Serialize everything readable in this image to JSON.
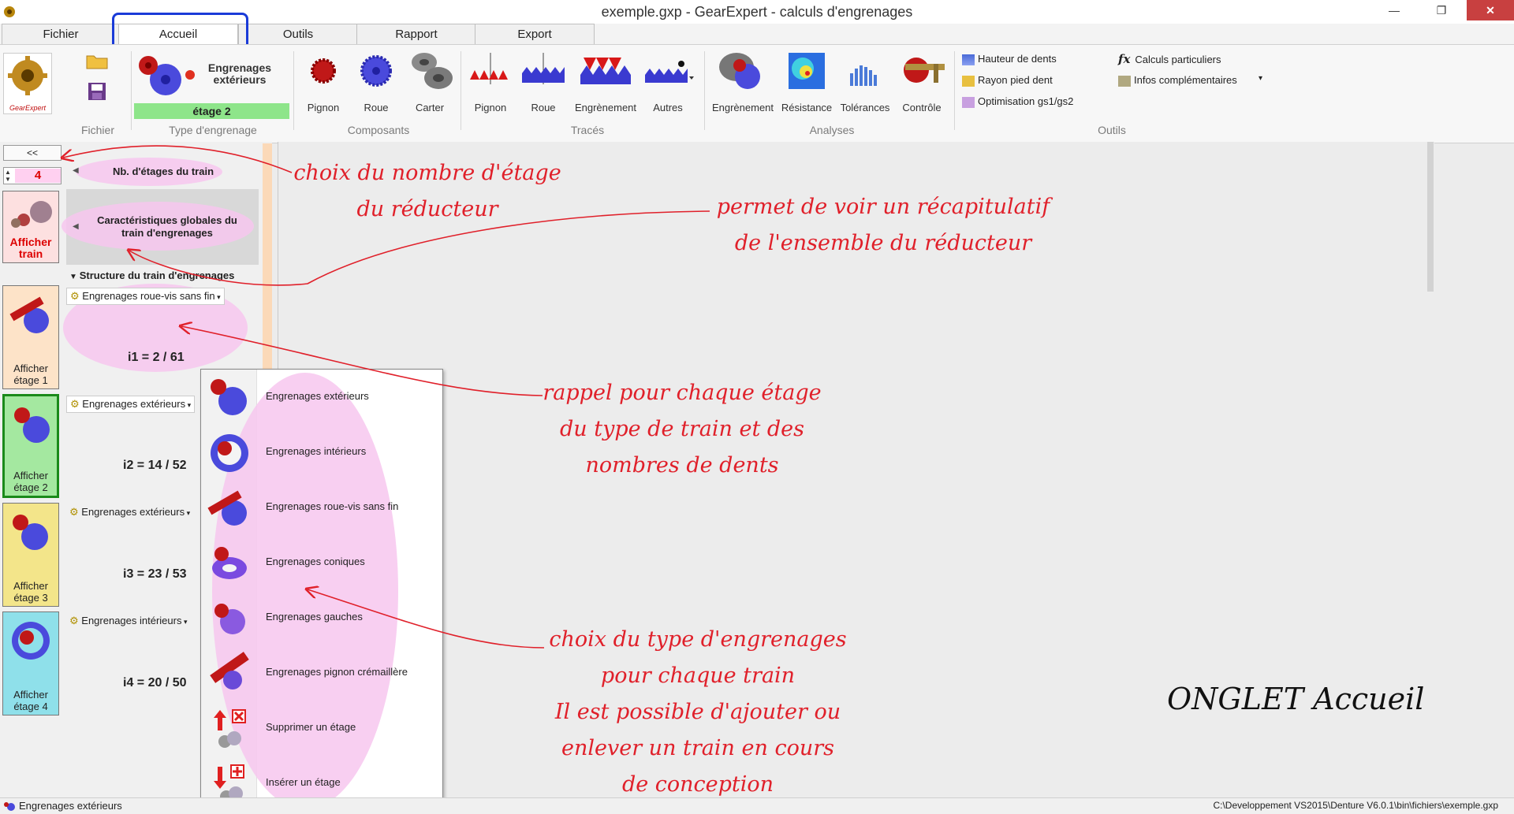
{
  "window": {
    "title": "exemple.gxp - GearExpert - calculs d'engrenages",
    "controls": {
      "minimize": "—",
      "maximize": "❐",
      "close": "✕"
    }
  },
  "tabs": [
    {
      "label": "Fichier"
    },
    {
      "label": "Accueil",
      "active": true
    },
    {
      "label": "Outils"
    },
    {
      "label": "Rapport"
    },
    {
      "label": "Export"
    }
  ],
  "ribbon": {
    "logo_text": "GearExpert",
    "gear_type": {
      "title": "Engrenages extérieurs",
      "stage": "étage 2"
    },
    "composants": [
      "Pignon",
      "Roue",
      "Carter"
    ],
    "traces": [
      "Pignon",
      "Roue",
      "Engrènement",
      "Autres"
    ],
    "analyses": [
      "Engrènement",
      "Résistance",
      "Tolérances",
      "Contrôle"
    ],
    "outils_col1": [
      "Hauteur de dents",
      "Rayon pied dent",
      "Optimisation gs1/gs2"
    ],
    "outils_col2": [
      "Calculs particuliers",
      "Infos complémentaires"
    ],
    "outils_fx": "fx",
    "groups": [
      "Fichier",
      "Type d'engrenage",
      "Composants",
      "Tracés",
      "Analyses",
      "Outils"
    ]
  },
  "left_panel": {
    "collapse_label": "<<",
    "stages_count": "4",
    "nb_stages_label": "Nb. d'étages du train",
    "global_label": "Caractéristiques globales du train d'engrenages",
    "show_train_label": "Afficher train",
    "structure_label": "Structure du train d'engrenages",
    "stages": [
      {
        "button": "Afficher étage 1",
        "type": "Engrenages roue-vis sans fin",
        "ratio": "i1 = 2 / 61",
        "color": "#fde3c8"
      },
      {
        "button": "Afficher étage 2",
        "type": "Engrenages extérieurs",
        "ratio": "i2 = 14 / 52",
        "color": "#8fd48c"
      },
      {
        "button": "Afficher étage 3",
        "type": "Engrenages extérieurs",
        "ratio": "i3 = 23 / 53",
        "color": "#f3e58a"
      },
      {
        "button": "Afficher étage 4",
        "type": "Engrenages intérieurs",
        "ratio": "i4 = 20 / 50",
        "color": "#8fe0ea"
      }
    ]
  },
  "dropdown": {
    "items": [
      "Engrenages extérieurs",
      "Engrenages intérieurs",
      "Engrenages roue-vis sans fin",
      "Engrenages coniques",
      "Engrenages gauches",
      "Engrenages pignon crémaillère",
      "Supprimer un étage",
      "Insérer un étage"
    ]
  },
  "annotations": {
    "a1": [
      "choix du nombre d'étage",
      "du réducteur"
    ],
    "a2": [
      "permet de voir un récapitulatif",
      "de l'ensemble du réducteur"
    ],
    "a3": [
      "rappel pour chaque étage",
      "du type de train et des",
      "nombres de dents"
    ],
    "a4": [
      "choix du type d'engrenages",
      "pour chaque train",
      "Il est possible d'ajouter ou",
      "enlever un train en cours",
      "de conception"
    ],
    "onglet": "ONGLET Accueil"
  },
  "status": {
    "left": "Engrenages extérieurs",
    "right": "C:\\Developpement VS2015\\Denture V6.0.1\\bin\\fichiers\\exemple.gxp"
  },
  "colors": {
    "annotation": "#e0202a",
    "highlight": "#1a3bd8",
    "stage_green": "#a4e8a0",
    "pink": "#f7c7ee"
  }
}
